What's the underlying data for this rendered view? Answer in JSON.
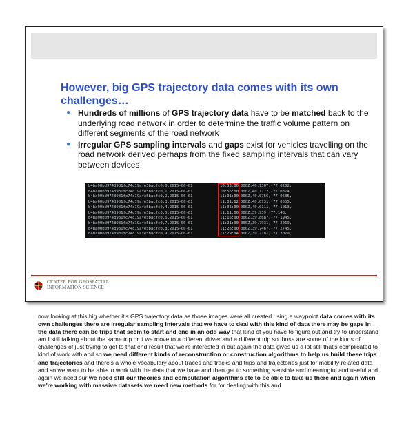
{
  "slide": {
    "title": "However, big GPS trajectory data comes with its own challenges…",
    "bullets": [
      {
        "segments": [
          {
            "text": "Hundreds of millions",
            "bold": true
          },
          {
            "text": " of ",
            "bold": false
          },
          {
            "text": "GPS trajectory data",
            "bold": true
          },
          {
            "text": " have to be ",
            "bold": false
          },
          {
            "text": "matched",
            "bold": true
          },
          {
            "text": " back to the underlying road network in order to determine the traffic volume pattern on different segments of the road network",
            "bold": false
          }
        ]
      },
      {
        "segments": [
          {
            "text": " Irregular GPS sampling intervals",
            "bold": true
          },
          {
            "text": " and ",
            "bold": false
          },
          {
            "text": "gaps",
            "bold": true
          },
          {
            "text": " exist for vehicles travelling on the road network derived perhaps from the fixed sampling intervals that can vary between devices",
            "bold": false
          }
        ]
      }
    ],
    "table_rows": [
      {
        "left": "b4ba00bd9748981fc74c19afe5bacfc0,0,2015-06-01",
        "time": "10:53:00",
        "right": "000Z,40.1307,-77.0202,"
      },
      {
        "left": "b4ba00bd9748981fc74c19afe5bacfc0,1,2015-06-01",
        "time": "10:56:00",
        "right": "000Z,40.1172,-77.0374,"
      },
      {
        "left": "b4ba00bd9748981fc74c19afe5bacfc0,2,2015-06-01",
        "time": "11:01:00",
        "right": "000Z,40.0756,-77.0535,"
      },
      {
        "left": "b4ba00bd9748981fc74c19afe5bacfc0,3,2015-06-01",
        "time": "11:01:12",
        "right": "000Z,40.0731,-77.0555,"
      },
      {
        "left": "b4ba00bd9748981fc74c19afe5bacfc0,4,2015-06-01",
        "time": "11:06:00",
        "right": "000Z,40.0111,-77.1013,"
      },
      {
        "left": "b4ba00bd9748981fc74c19afe5bacfc0,5,2015-06-01",
        "time": "11:11:00",
        "right": "000Z,39.939,-77.143,"
      },
      {
        "left": "b4ba00bd9748981fc74c19afe5bacfc0,6,2015-06-01",
        "time": "11:16:00",
        "right": "000Z,39.8687,-77.1945,"
      },
      {
        "left": "b4ba00bd9748981fc74c19afe5bacfc0,7,2015-06-01",
        "time": "11:21:00",
        "right": "000Z,39.7931,-77.2069,"
      },
      {
        "left": "b4ba00bd9748981fc74c19afe5bacfc0,8,2015-06-01",
        "time": "11:26:00",
        "right": "000Z,39.7467,-77.2745,"
      },
      {
        "left": "b4ba00bd9748981fc74c19afe5bacfc0,9,2015-06-01",
        "time": "11:29:04",
        "right": "000Z,39.7181,-77.3079,"
      }
    ],
    "footer": {
      "line1": "CENTER FOR GEOSPATIAL",
      "line2": "INFORMATION SCIENCE"
    },
    "colors": {
      "title": "#2d4fc4",
      "bullet": "#3a7bd5",
      "footer_rule": "#cc2222",
      "highlight_box": "#dd2222"
    }
  },
  "transcript": [
    {
      "text": "now looking at this big whether it's GPS trajectory data as those images were all created using a waypoint ",
      "bold": false
    },
    {
      "text": "data comes with its own challenges there are irregular sampling intervals that we have to deal with this kind of data there may be gaps in the data there can be trips that seem to start and end in an odd way",
      "bold": true
    },
    {
      "text": " that kind of you have to figure out and try to understand am I still talking about the same trip or if we move to a different driver and a different trip so those are some of the kinds of challenges of just trying to get to that end result that we're interested in but again the data gives us a lot still that's complicated to kind of work with and so ",
      "bold": false
    },
    {
      "text": "we need different kinds of reconstruction or construction algorithms to help us build these trips and trajectories",
      "bold": true
    },
    {
      "text": " and there's a whole vocabulary about traces and tracks and trips and trajectories just for mobility related data and so we want to be able to work with the data that we have and then get to something sensible and meaningful and useful and again we need our ",
      "bold": false
    },
    {
      "text": "we need still our theories and computation algorithms etc to be able to take us there and again when we're working with massive datasets we need new methods",
      "bold": true
    },
    {
      "text": " for for dealing with this and",
      "bold": false
    }
  ]
}
